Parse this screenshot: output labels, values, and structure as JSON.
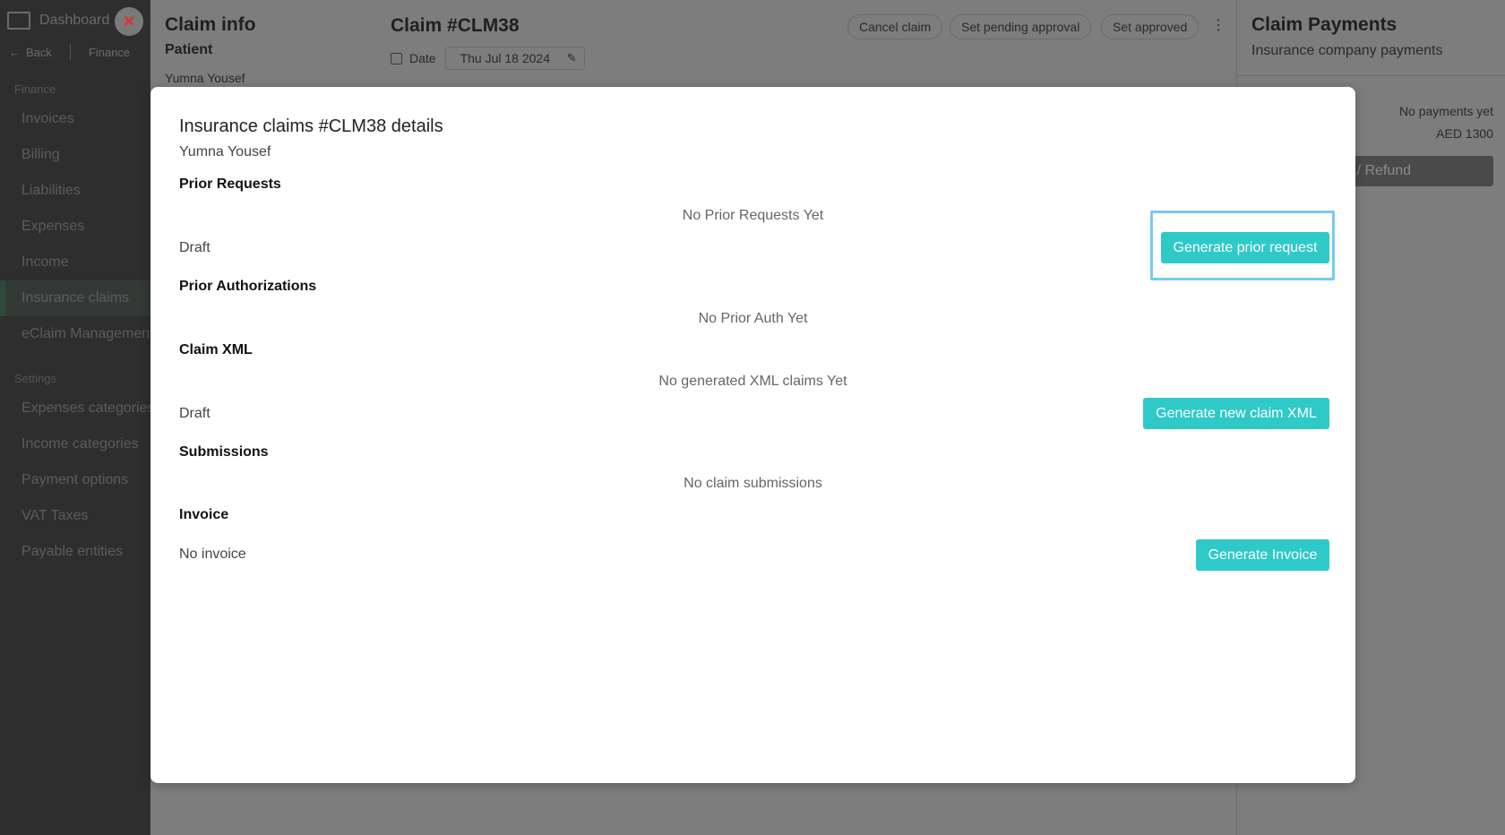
{
  "sidebar": {
    "title": "Dashboard",
    "close_symbol": "✕",
    "nav_back": "Back",
    "nav_crumb": "Finance",
    "section_finance": "Finance",
    "items": [
      "Invoices",
      "Billing",
      "Liabilities",
      "Expenses",
      "Income",
      "Insurance claims",
      "eClaim Management"
    ],
    "section_settings": "Settings",
    "settings_items": [
      "Expenses categories",
      "Income categories",
      "Payment options",
      "VAT Taxes",
      "Payable entities"
    ]
  },
  "claim_info": {
    "title": "Claim info",
    "subtitle": "Patient",
    "patient_name": "Yumna Yousef"
  },
  "claim": {
    "title": "Claim #CLM38",
    "actions": [
      "Cancel claim",
      "Set pending approval",
      "Set approved"
    ],
    "more": "⋮",
    "date_label": "Date",
    "date_value": "Thu Jul 18 2024"
  },
  "payments": {
    "title": "Claim Payments",
    "subtitle": "Insurance company payments",
    "none": "No payments yet",
    "amount": "AED 1300",
    "button": "Payment / Refund"
  },
  "modal": {
    "title": "Insurance claims #CLM38 details",
    "patient": "Yumna Yousef",
    "prior_requests": {
      "heading": "Prior Requests",
      "empty": "No Prior Requests Yet",
      "status": "Draft",
      "button": "Generate prior request"
    },
    "prior_auth": {
      "heading": "Prior Authorizations",
      "empty": "No Prior Auth Yet"
    },
    "claim_xml": {
      "heading": "Claim XML",
      "empty": "No generated XML claims Yet",
      "status": "Draft",
      "button": "Generate new claim XML"
    },
    "submissions": {
      "heading": "Submissions",
      "empty": "No claim submissions"
    },
    "invoice": {
      "heading": "Invoice",
      "status": "No invoice",
      "button": "Generate Invoice"
    }
  },
  "colors": {
    "accent": "#2fc9c8",
    "focus": "#79c9f0",
    "overlay": "#7d7d7d"
  }
}
